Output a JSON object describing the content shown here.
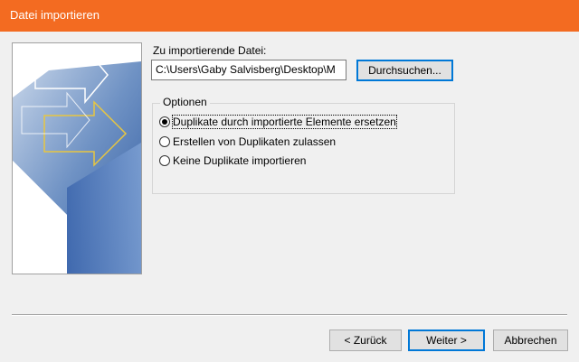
{
  "window": {
    "title": "Datei importieren",
    "accent_color": "#f36b21"
  },
  "file": {
    "label": "Zu importierende Datei:",
    "value": "C:\\Users\\Gaby Salvisberg\\Desktop\\M",
    "browse_label": "Durchsuchen..."
  },
  "options": {
    "legend": "Optionen",
    "items": [
      {
        "label": "Duplikate durch importierte Elemente ersetzen",
        "checked": true
      },
      {
        "label": "Erstellen von Duplikaten zulassen",
        "checked": false
      },
      {
        "label": "Keine Duplikate importieren",
        "checked": false
      }
    ]
  },
  "buttons": {
    "back": "< Zurück",
    "next": "Weiter >",
    "cancel": "Abbrechen"
  },
  "banner": {
    "icon": "import-arrows-illustration"
  }
}
